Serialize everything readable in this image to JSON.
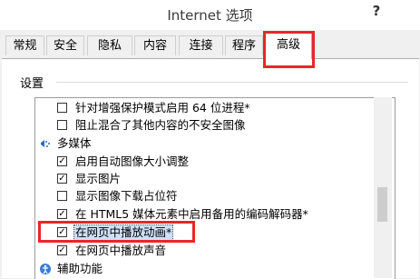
{
  "window": {
    "title": "Internet 选项",
    "help_label": "?"
  },
  "tabs": [
    {
      "label": "常规"
    },
    {
      "label": "安全"
    },
    {
      "label": "隐私"
    },
    {
      "label": "内容"
    },
    {
      "label": "连接"
    },
    {
      "label": "程序"
    },
    {
      "label": "高级",
      "active": true
    }
  ],
  "settings": {
    "section_label": "设置",
    "rows": [
      {
        "type": "checkbox",
        "checked": false,
        "label": "针对增强保护模式启用 64 位进程*"
      },
      {
        "type": "checkbox",
        "checked": false,
        "label": "阻止混合了其他内容的不安全图像"
      },
      {
        "type": "category",
        "icon": "multimedia-icon",
        "label": "多媒体"
      },
      {
        "type": "checkbox",
        "checked": true,
        "label": "启用自动图像大小调整"
      },
      {
        "type": "checkbox",
        "checked": true,
        "label": "显示图片"
      },
      {
        "type": "checkbox",
        "checked": false,
        "label": "显示图像下载占位符"
      },
      {
        "type": "checkbox",
        "checked": true,
        "label": "在 HTML5 媒体元素中启用备用的编码解码器*"
      },
      {
        "type": "checkbox",
        "checked": true,
        "label": "在网页中播放动画*",
        "selected": true
      },
      {
        "type": "checkbox",
        "checked": true,
        "label": "在网页中播放声音"
      },
      {
        "type": "category",
        "icon": "accessibility-icon",
        "label": "辅助功能"
      }
    ]
  },
  "colors": {
    "highlight": "#e8262a",
    "selection": "#cfe0f8"
  }
}
